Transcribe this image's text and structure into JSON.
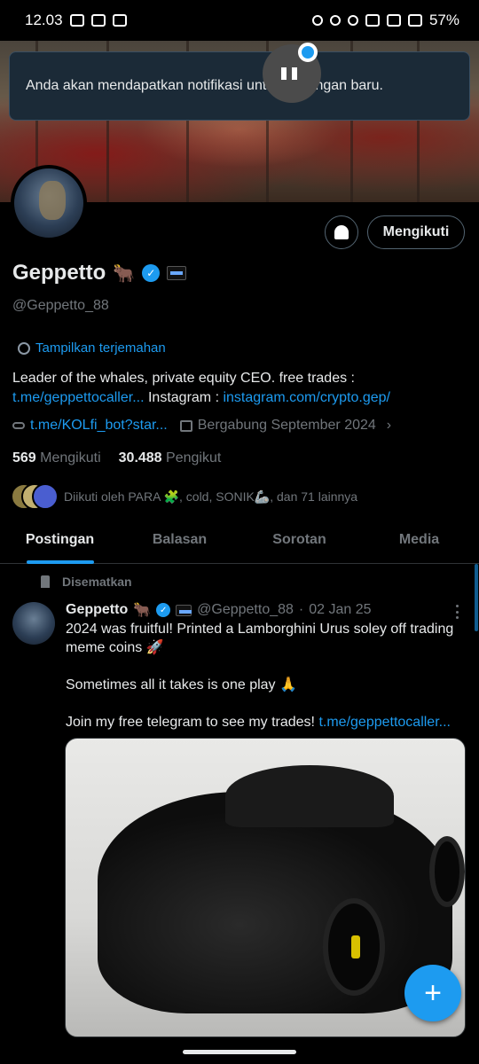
{
  "status_bar": {
    "time": "12.03",
    "battery": "57%"
  },
  "toast": {
    "message": "Anda akan mendapatkan notifikasi untuk postingan baru."
  },
  "profile": {
    "name": "Geppetto",
    "name_emoji": "🐂",
    "handle": "@Geppetto_88",
    "follow_button": "Mengikuti",
    "translate_label": "Tampilkan terjemahan",
    "bio_text_1": "Leader of the whales, private equity CEO. free trades : ",
    "bio_link_1": "t.me/geppettocaller...",
    "bio_text_2": " Instagram : ",
    "bio_link_2": "instagram.com/crypto.gep/",
    "website": "t.me/KOLfi_bot?star...",
    "joined": "Bergabung September 2024",
    "following_count": "569",
    "following_label": "Mengikuti",
    "followers_count": "30.488",
    "followers_label": "Pengikut",
    "followed_by": "Diikuti oleh PARA 🧩, cold, SONIK🦾, dan 71 lainnya"
  },
  "tabs": [
    {
      "label": "Postingan",
      "active": true
    },
    {
      "label": "Balasan",
      "active": false
    },
    {
      "label": "Sorotan",
      "active": false
    },
    {
      "label": "Media",
      "active": false
    }
  ],
  "post": {
    "pinned_label": "Disematkan",
    "author_name": "Geppetto",
    "author_emoji": "🐂",
    "author_handle": "@Geppetto_88",
    "separator": "·",
    "date": "02 Jan 25",
    "line_1": "2024 was fruitful! Printed a Lamborghini Urus soley off trading meme coins 🚀",
    "line_2": "Sometimes all it takes is one play 🙏",
    "line_3_text": "Join my free telegram to see my trades! ",
    "line_3_link": "t.me/geppettocaller..."
  },
  "fab": {
    "label": "+"
  },
  "colors": {
    "accent": "#1d9bf0",
    "background": "#000000",
    "muted": "#71767b"
  }
}
